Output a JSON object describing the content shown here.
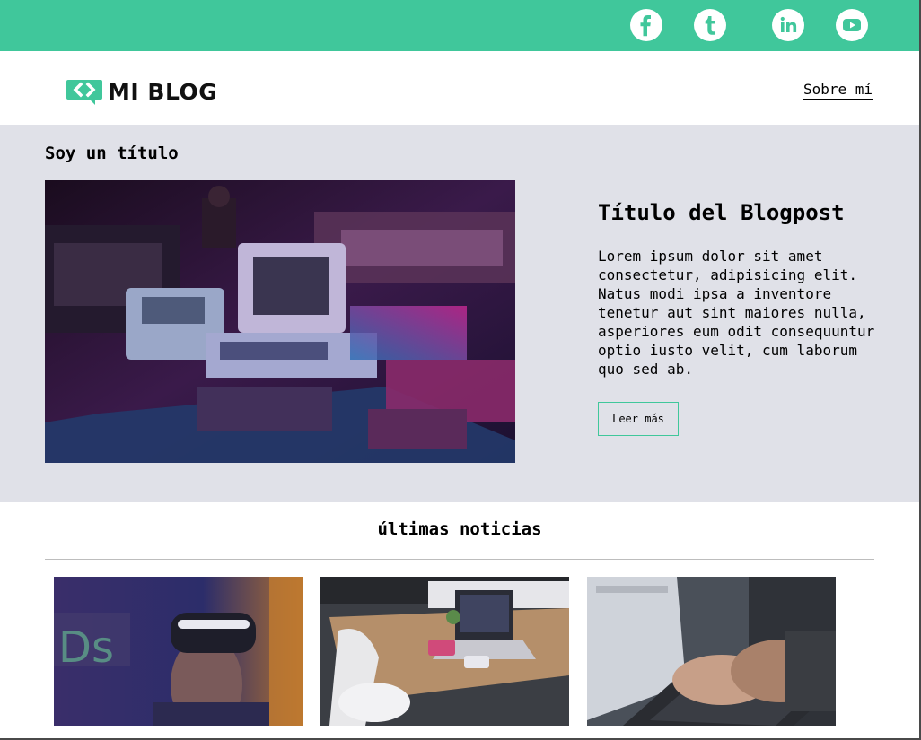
{
  "topbar": {
    "color": "#40c79b",
    "social": [
      {
        "name": "facebook",
        "icon": "facebook-icon"
      },
      {
        "name": "tumblr",
        "icon": "tumblr-icon"
      },
      {
        "name": "linkedin",
        "icon": "linkedin-icon"
      },
      {
        "name": "youtube",
        "icon": "youtube-icon"
      }
    ]
  },
  "header": {
    "logo_text": "MI BLOG",
    "nav_about": "Sobre mí"
  },
  "hero": {
    "section_title": "Soy un título",
    "post_title": "Título del Blogpost",
    "post_body": "Lorem ipsum dolor sit amet consectetur, adipisicing elit. Natus modi ipsa a inventore tenetur aut sint maiores nulla, asperiores eum odit consequuntur optio iusto velit, cum laborum quo sed ab.",
    "read_more": "Leer más",
    "image_subject": "retro computers and consoles under neon light"
  },
  "news": {
    "title": "últimas noticias",
    "cards": [
      {
        "image_subject": "person wearing VR headset"
      },
      {
        "image_subject": "laptop and phone on wooden desk"
      },
      {
        "image_subject": "hands typing on laptop"
      }
    ]
  },
  "colors": {
    "accent": "#40c79b",
    "hero_bg": "#e0e1e8"
  }
}
